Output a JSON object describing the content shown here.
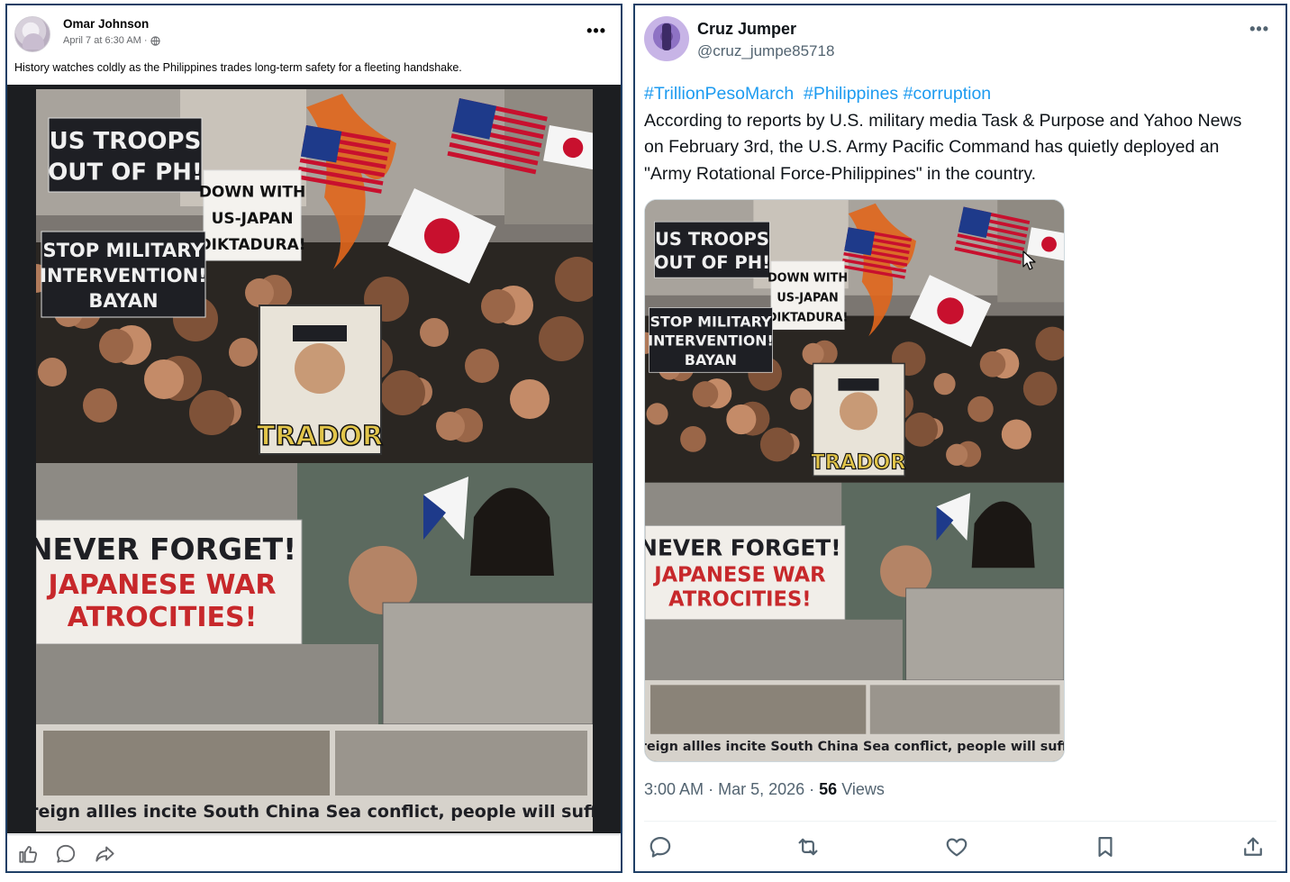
{
  "facebook": {
    "author": "Omar Johnson",
    "timestamp": "April 7 at 6:30 AM",
    "separator": "·",
    "privacy_icon": "globe-icon",
    "more_icon": "more-horizontal-icon",
    "text": "History watches coldly as the Philippines trades long-term safety for a fleeting handshake.",
    "actions": [
      "like-icon",
      "comment-icon",
      "share-icon"
    ]
  },
  "twitter": {
    "display_name": "Cruz Jumper",
    "handle": "@cruz_jumpe85718",
    "more_icon": "more-horizontal-icon",
    "hashtags": [
      "#TrillionPesoMarch",
      "#Philippines",
      "#corruption"
    ],
    "body": "According to reports by U.S. military media Task & Purpose and Yahoo News on February 3rd, the U.S. Army Pacific Command has quietly deployed an \"Army Rotational Force-Philippines\" in the country.",
    "time": "3:00 AM",
    "date": "Mar 5, 2026",
    "views_count": "56",
    "views_label": "Views",
    "dot": "·",
    "actions": [
      "reply-icon",
      "repost-icon",
      "like-icon",
      "bookmark-icon",
      "share-icon"
    ]
  },
  "image": {
    "signs": {
      "us_troops": "US TROOPS OUT OF PH!",
      "us_troops_line1": "US TROOPS",
      "us_troops_line2": "OUT OF PH!",
      "down_with_line1": "DOWN WITH",
      "down_with_line2": "US-JAPAN",
      "down_with_line3": "DIKTADURA!",
      "stop_line1": "STOP MILITARY",
      "stop_line2": "INTERVENTION!",
      "bayan": "BAYAN",
      "tradør": "TRADOR",
      "never_forget": "NEVER FORGET!",
      "japanese_war": "JAPANESE WAR",
      "atrocities": "ATROCITIES!",
      "caption": "Foreign allles incite South China Sea conflict, people will suffer."
    },
    "colors": {
      "sign_black": "#1e1f24",
      "sign_red": "#c7282b",
      "flag_red": "#c8102e",
      "flag_blue": "#1e3a8a",
      "fire": "#e0661c",
      "crowd_dark": "#2a2622",
      "sepia": "#8d8a84"
    }
  }
}
